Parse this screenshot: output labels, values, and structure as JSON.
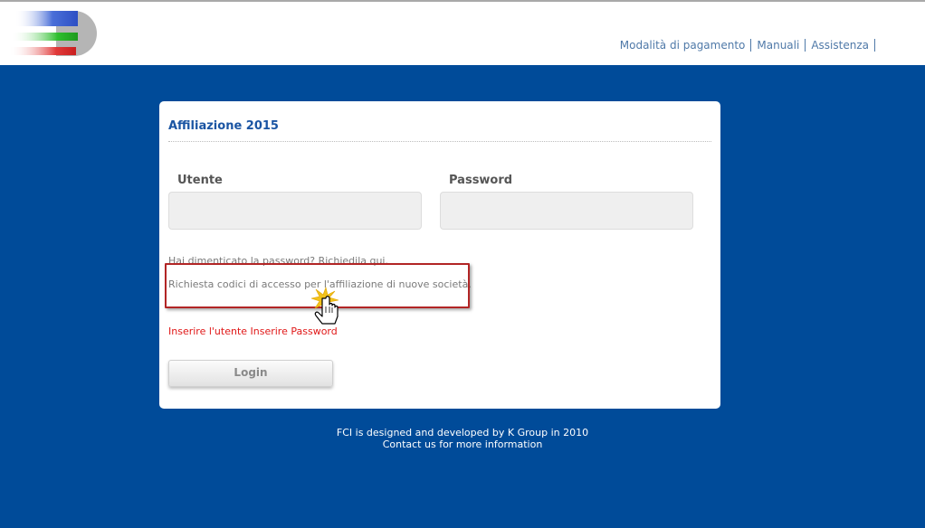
{
  "nav": {
    "items": [
      "Modalità di pagamento",
      "Manuali",
      "Assistenza"
    ]
  },
  "card": {
    "title": "Affiliazione 2015",
    "user_label": "Utente",
    "password_label": "Password",
    "user_value": "",
    "password_value": "",
    "forgot_password_link": "Hai dimenticato la password? Richiedila qui.",
    "new_company_link": "Richiesta codici di accesso per l'affiliazione di nuove società.",
    "error_message": "Inserire l'utente Inserire Password",
    "login_label": "Login"
  },
  "footer": {
    "line1": "FCI is designed and developed by K Group in 2010",
    "line2": "Contact us for more information"
  },
  "colors": {
    "background": "#004b99",
    "accent": "#1b55a3",
    "error": "#e01818",
    "highlight": "#b22525"
  },
  "icons": [
    "fci-logo-icon",
    "hand-pointer-cursor-icon"
  ]
}
